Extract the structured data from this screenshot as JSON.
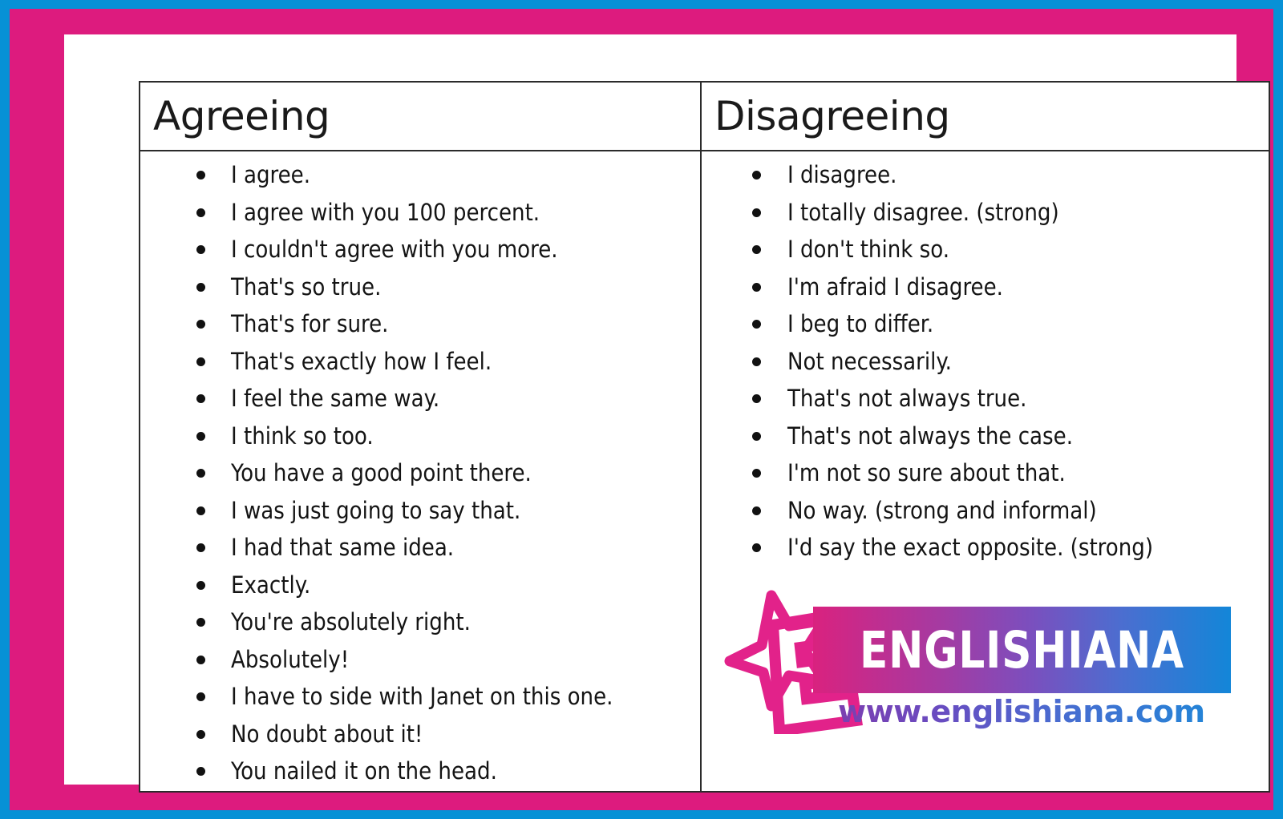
{
  "frame": {
    "outer_border_color": "#0791D6",
    "inner_border_color": "#DD1B7E",
    "card_color": "#FFFFFF"
  },
  "table": {
    "columns": [
      {
        "id": "agreeing",
        "header": "Agreeing",
        "items": [
          "I agree.",
          "I agree with you 100 percent.",
          "I couldn't agree with you more.",
          "That's so true.",
          "That's for sure.",
          "That's exactly how I feel.",
          "I feel the same way.",
          "I think so too.",
          "You have a good point there.",
          "I was just going to say that.",
          "I had that same idea.",
          "Exactly.",
          "You're absolutely right.",
          "Absolutely!",
          "I have to side with Janet on this one.",
          "No doubt about it!",
          "You nailed it on the head."
        ]
      },
      {
        "id": "disagreeing",
        "header": "Disagreeing",
        "items": [
          "I disagree.",
          "I totally disagree. (strong)",
          "I don't think so.",
          "I'm afraid I disagree.",
          "I beg to differ.",
          "Not necessarily.",
          "That's not always true.",
          "That's not always the case.",
          "I'm not so sure about that.",
          "No way. (strong and informal)",
          "I'd say the exact opposite. (strong)"
        ]
      }
    ]
  },
  "logo": {
    "wordmark": "ENGLISHIANA",
    "url": "www.englishiana.com",
    "star_color": "#E2228A",
    "gradient_start": "#D9227F",
    "gradient_mid": "#7B4FBE",
    "gradient_end": "#1386D8"
  }
}
